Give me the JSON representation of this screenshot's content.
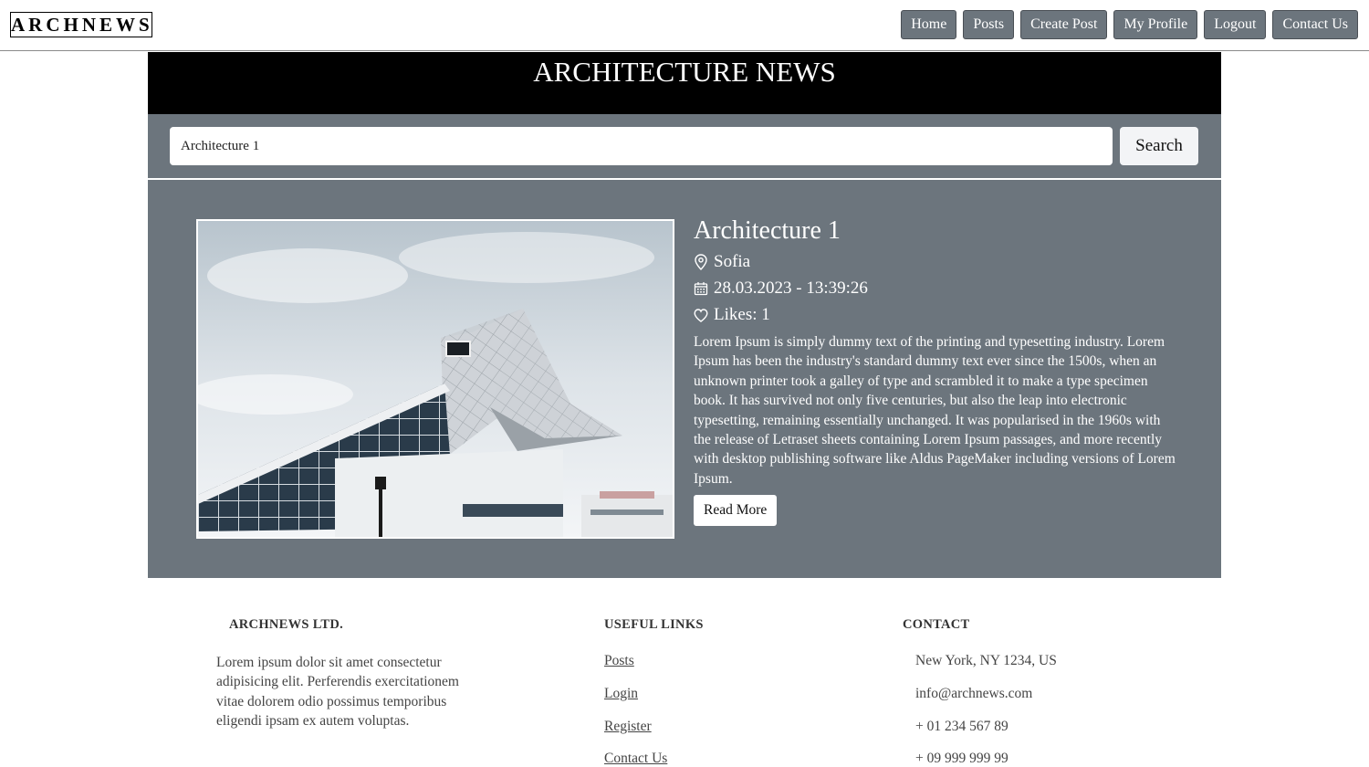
{
  "navbar": {
    "logo": "ARCHNEWS",
    "links": [
      "Home",
      "Posts",
      "Create Post",
      "My Profile",
      "Logout",
      "Contact Us"
    ]
  },
  "hero": {
    "title": "ARCHITECTURE NEWS"
  },
  "search": {
    "value": "Architecture 1",
    "button_label": "Search"
  },
  "post": {
    "title": "Architecture 1",
    "location": "Sofia",
    "date": "28.03.2023 - 13:39:26",
    "likes": "Likes: 1",
    "body": "Lorem Ipsum is simply dummy text of the printing and typesetting industry. Lorem Ipsum has been the industry's standard dummy text ever since the 1500s, when an unknown printer took a galley of type and scrambled it to make a type specimen book. It has survived not only five centuries, but also the leap into electronic typesetting, remaining essentially unchanged. It was popularised in the 1960s with the release of Letraset sheets containing Lorem Ipsum passages, and more recently with desktop publishing software like Aldus PageMaker including versions of Lorem Ipsum.",
    "read_more": "Read More"
  },
  "footer": {
    "about_heading": "ARCHNEWS LTD.",
    "about_text": "Lorem ipsum dolor sit amet consectetur adipisicing elit. Perferendis exercitationem vitae dolorem odio possimus temporibus eligendi ipsam ex autem voluptas.",
    "links_heading": "USEFUL LINKS",
    "links": [
      "Posts",
      "Login",
      "Register",
      "Contact Us"
    ],
    "contact_heading": "CONTACT",
    "contact": [
      "New York, NY 1234, US",
      "info@archnews.com",
      "+ 01 234 567 89",
      "+ 09 999 999 99"
    ]
  }
}
